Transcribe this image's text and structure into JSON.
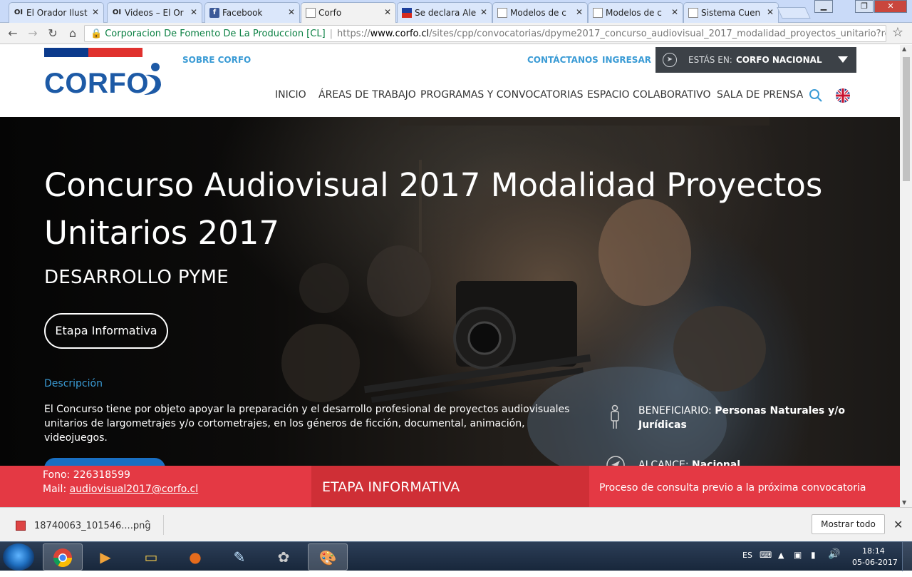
{
  "browser": {
    "tabs": [
      {
        "label": "El Orador Ilust",
        "favicon": "OI",
        "active": false
      },
      {
        "label": "Videos – El Or",
        "favicon": "OI",
        "active": false
      },
      {
        "label": "Facebook",
        "favicon": "f",
        "active": false
      },
      {
        "label": "Corfo",
        "favicon": "page",
        "active": true
      },
      {
        "label": "Se declara Ale",
        "favicon": "flag",
        "active": false
      },
      {
        "label": "Modelos de c",
        "favicon": "page",
        "active": false
      },
      {
        "label": "Modelos de c",
        "favicon": "page",
        "active": false
      },
      {
        "label": "Sistema Cuen",
        "favicon": "page",
        "active": false
      }
    ],
    "close_glyph": "✕",
    "address": {
      "site_name": "Corporacion De Fomento De La Produccion [CL]",
      "url_scheme": "https://",
      "url_host": "www.corfo.cl",
      "url_path": "/sites/cpp/convocatorias/dpyme2017_concurso_audiovisual_2017_modalidad_proyectos_unitario?resol"
    }
  },
  "header": {
    "logo_text": "CORFO",
    "about_link": "SOBRE CORFO",
    "contact_link": "CONTÁCTANOS",
    "login_link": "INGRESAR",
    "region_label": "ESTÁS EN:",
    "region_value": "CORFO NACIONAL",
    "nav": [
      "INICIO",
      "ÁREAS DE TRABAJO",
      "PROGRAMAS Y CONVOCATORIAS",
      "ESPACIO COLABORATIVO",
      "SALA DE PRENSA"
    ],
    "colors": {
      "accent": "#3a9bd5",
      "logo_blue": "#1d5aa6",
      "flag_red": "#e0312e",
      "flag_blue": "#0b3a8c"
    }
  },
  "hero": {
    "title": "Concurso Audiovisual 2017 Modalidad Proyectos Unitarios 2017",
    "subtitle": "DESARROLLO PYME",
    "stage_button": "Etapa Informativa",
    "description_label": "Descripción",
    "description_text": "El Concurso tiene por objeto apoyar la preparación y el desarrollo profesional de proyectos audiovisuales unitarios de largometrajes y/o cortometrajes, en los géneros de ficción, documental, animación, videojuegos.",
    "beneficiary_label": "BENEFICIARIO:",
    "beneficiary_value": "Personas Naturales y/o Jurídicas",
    "scope_label": "ALCANCE:",
    "scope_value": "Nacional"
  },
  "contact_bar": {
    "phone": "Fono: 226318599",
    "mail_label": "Mail:",
    "mail_value": "audiovisual2017@corfo.cl",
    "stage": "ETAPA INFORMATIVA",
    "stage_desc": "Proceso de consulta previo a la próxima convocatoria",
    "colors": {
      "bar": "#e43944",
      "mid": "#cf2f36"
    }
  },
  "downloads": {
    "file_name": "18740063_101546....png",
    "show_all": "Mostrar todo"
  },
  "taskbar": {
    "language": "ES",
    "time": "18:14",
    "date": "05-06-2017"
  }
}
